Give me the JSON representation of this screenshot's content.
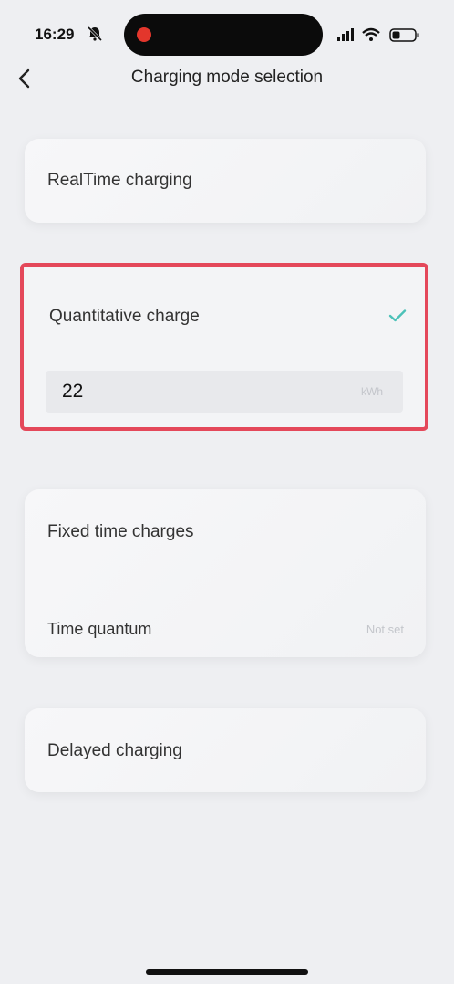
{
  "status_bar": {
    "time": "16:29"
  },
  "nav": {
    "title": "Charging mode selection"
  },
  "modes": {
    "realtime": {
      "label": "RealTime charging"
    },
    "quantitative": {
      "label": "Quantitative charge",
      "value": "22",
      "unit": "kWh",
      "selected": true
    },
    "fixed_time": {
      "label": "Fixed time charges",
      "sub_label": "Time quantum",
      "sub_value": "Not set"
    },
    "delayed": {
      "label": "Delayed charging"
    }
  },
  "colors": {
    "accent_check": "#4cc1b8",
    "highlight_border": "#e4485a",
    "background": "#eeeff2"
  }
}
